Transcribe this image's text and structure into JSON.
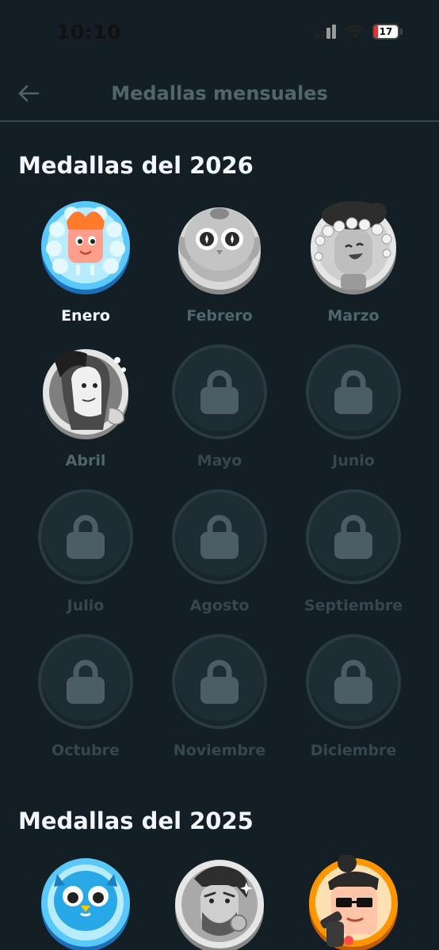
{
  "status_bar": {
    "time": "10:10",
    "battery": "17"
  },
  "header": {
    "title": "Medallas mensuales"
  },
  "sections": [
    {
      "title": "Medallas del 2026",
      "medals": [
        {
          "label": "Enero",
          "state": "active",
          "icon": "lion-medal-icon"
        },
        {
          "label": "Febrero",
          "state": "unlocked",
          "icon": "owl-medal-icon"
        },
        {
          "label": "Marzo",
          "state": "unlocked",
          "icon": "flower-crown-medal-icon"
        },
        {
          "label": "Abril",
          "state": "unlocked",
          "icon": "character-medal-icon"
        },
        {
          "label": "Mayo",
          "state": "locked",
          "icon": "lock-icon"
        },
        {
          "label": "Junio",
          "state": "locked",
          "icon": "lock-icon"
        },
        {
          "label": "Julio",
          "state": "locked",
          "icon": "lock-icon"
        },
        {
          "label": "Agosto",
          "state": "locked",
          "icon": "lock-icon"
        },
        {
          "label": "Septiembre",
          "state": "locked",
          "icon": "lock-icon"
        },
        {
          "label": "Octubre",
          "state": "locked",
          "icon": "lock-icon"
        },
        {
          "label": "Noviembre",
          "state": "locked",
          "icon": "lock-icon"
        },
        {
          "label": "Diciembre",
          "state": "locked",
          "icon": "lock-icon"
        }
      ]
    },
    {
      "title": "Medallas del 2025",
      "medals": [
        {
          "label": "",
          "state": "active",
          "icon": "blue-owl-medal-icon"
        },
        {
          "label": "",
          "state": "unlocked",
          "icon": "bearded-character-medal-icon"
        },
        {
          "label": "",
          "state": "active",
          "icon": "sunglasses-character-medal-icon"
        }
      ]
    }
  ],
  "colors": {
    "background": "#131f24",
    "divider": "#37464f",
    "label_active": "#f1f7fb",
    "label_unlocked": "#52656d",
    "label_locked": "#37464f",
    "lock_icon": "#4b5e66"
  }
}
